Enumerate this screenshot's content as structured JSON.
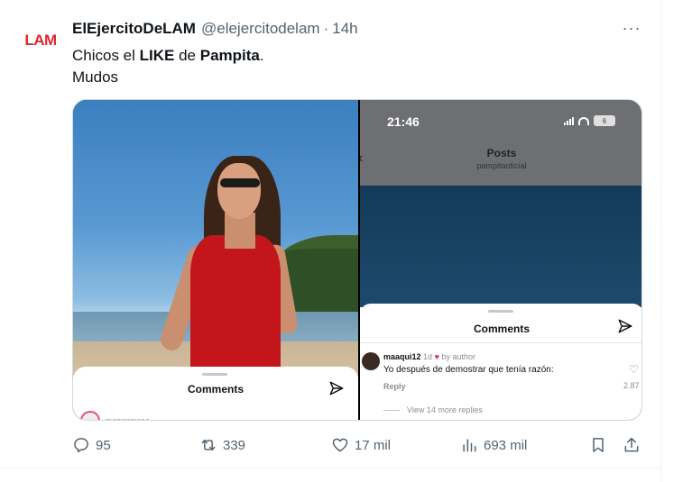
{
  "tweet": {
    "avatar_text": "LAM",
    "display_name": "ElEjercitoDeLAM",
    "handle": "@elejercitodelam",
    "separator": "·",
    "time": "14h",
    "more_label": "···",
    "text": {
      "line1_a": "Chicos el ",
      "line1_b": "LIKE",
      "line1_c": " de ",
      "line1_d": "Pampita",
      "line1_e": ".",
      "line2": "Mudos"
    }
  },
  "media": {
    "left": {
      "sheet_title": "Comments",
      "sheet_user": "maruromano"
    },
    "right": {
      "clock": "21:46",
      "battery": "6",
      "posts_title": "Posts",
      "posts_sub": "pampitaoficial",
      "sheet_title": "Comments",
      "comment_user": "maaqui12",
      "comment_age": "1d",
      "comment_heart": "♥",
      "comment_by": "by author",
      "comment_text": "Yo después de demostrar que tenía razón:",
      "reply": "Reply",
      "like_count": "2.87",
      "view_more": "View 14 more replies"
    }
  },
  "actions": {
    "replies": "95",
    "retweets": "339",
    "likes": "17 mil",
    "views": "693 mil"
  },
  "colors": {
    "text_primary": "#0f1419",
    "text_secondary": "#536471",
    "avatar_red": "#e0272e",
    "border": "#cfd9de"
  }
}
